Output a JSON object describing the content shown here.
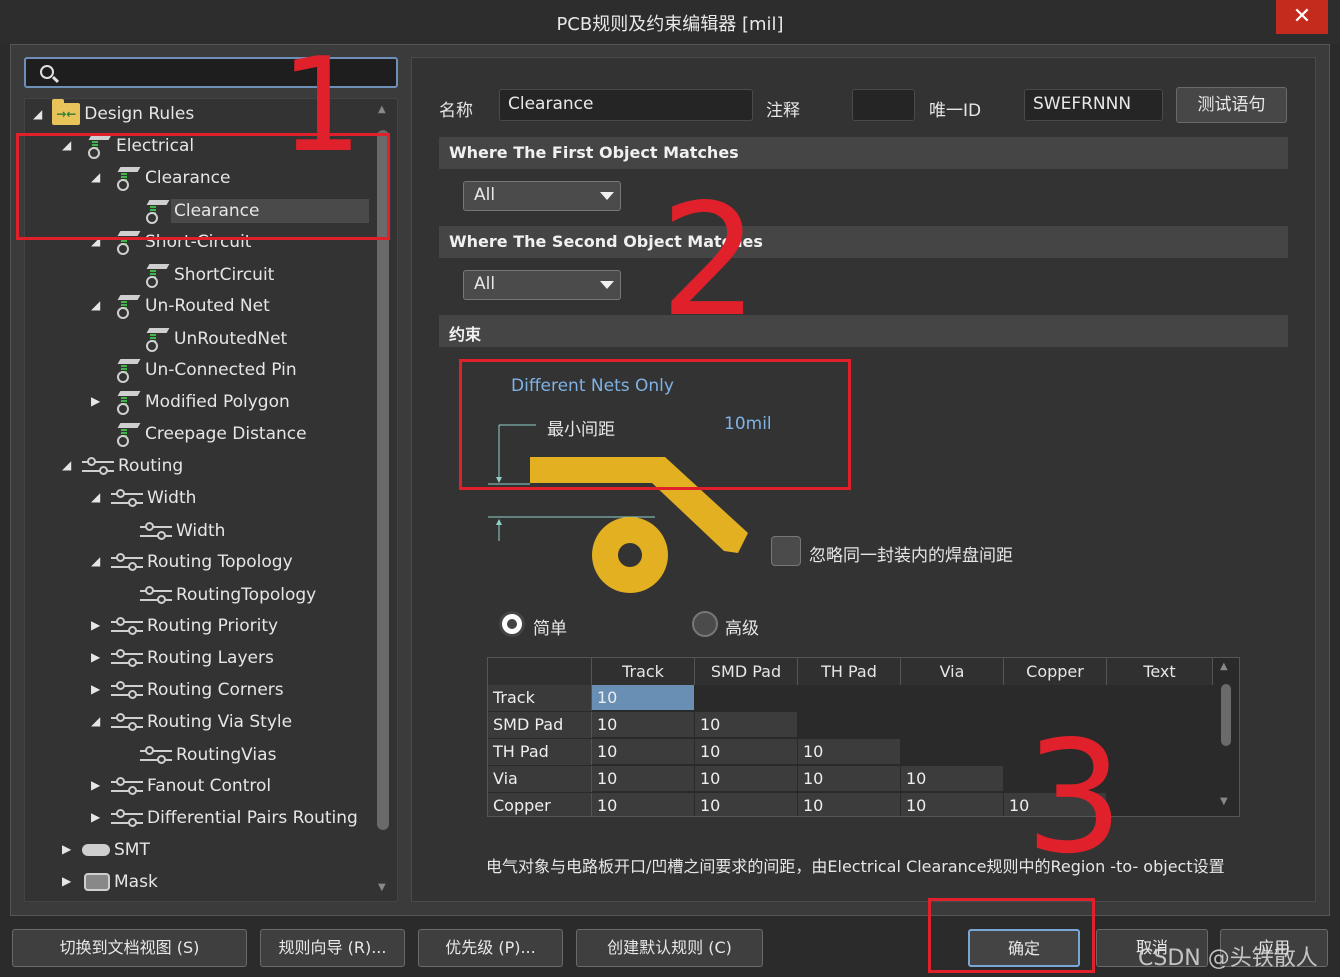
{
  "window": {
    "title": "PCB规则及约束编辑器 [mil]",
    "close_glyph": "✕"
  },
  "tree": {
    "root": "Design Rules",
    "items": [
      {
        "label": "Electrical"
      },
      {
        "label": "Clearance"
      },
      {
        "label": "Clearance"
      },
      {
        "label": "Short-Circuit"
      },
      {
        "label": "ShortCircuit"
      },
      {
        "label": "Un-Routed Net"
      },
      {
        "label": "UnRoutedNet"
      },
      {
        "label": "Un-Connected Pin"
      },
      {
        "label": "Modified Polygon"
      },
      {
        "label": "Creepage Distance"
      },
      {
        "label": "Routing"
      },
      {
        "label": "Width"
      },
      {
        "label": "Width"
      },
      {
        "label": "Routing Topology"
      },
      {
        "label": "RoutingTopology"
      },
      {
        "label": "Routing Priority"
      },
      {
        "label": "Routing Layers"
      },
      {
        "label": "Routing Corners"
      },
      {
        "label": "Routing Via Style"
      },
      {
        "label": "RoutingVias"
      },
      {
        "label": "Fanout Control"
      },
      {
        "label": "Differential Pairs Routing"
      },
      {
        "label": "SMT"
      },
      {
        "label": "Mask"
      }
    ]
  },
  "rule": {
    "name_label": "名称",
    "name_value": "Clearance",
    "comment_label": "注释",
    "comment_value": "",
    "id_label": "唯一ID",
    "id_value": "SWEFRNNN",
    "test_button": "测试语句"
  },
  "first_match": {
    "title": "Where The First Object Matches",
    "value": "All"
  },
  "second_match": {
    "title": "Where The Second Object Matches",
    "value": "All"
  },
  "constraint": {
    "title": "约束",
    "net_scope": "Different Nets Only",
    "min_clearance_label": "最小间距",
    "min_clearance_value": "10mil",
    "ignore_pad_label": "忽略同一封装内的焊盘间距",
    "mode_simple": "简单",
    "mode_advanced": "高级"
  },
  "grid": {
    "columns": [
      "Track",
      "SMD Pad",
      "TH Pad",
      "Via",
      "Copper",
      "Text"
    ],
    "rows": [
      {
        "name": "Track",
        "values": [
          "10"
        ]
      },
      {
        "name": "SMD Pad",
        "values": [
          "10",
          "10"
        ]
      },
      {
        "name": "TH Pad",
        "values": [
          "10",
          "10",
          "10"
        ]
      },
      {
        "name": "Via",
        "values": [
          "10",
          "10",
          "10",
          "10"
        ]
      },
      {
        "name": "Copper",
        "values": [
          "10",
          "10",
          "10",
          "10",
          "10"
        ]
      }
    ]
  },
  "description": "电气对象与电路板开口/凹槽之间要求的间距，由Electrical Clearance规则中的Region -to- object设置",
  "buttons": {
    "switch_view": "切换到文档视图 (S)",
    "wizard": "规则向导 (R)...",
    "priority": "优先级 (P)...",
    "create_default": "创建默认规则 (C)",
    "ok": "确定",
    "cancel": "取消",
    "apply": "应用"
  },
  "annotations": {
    "n1": "1",
    "n2": "2",
    "n3": "3"
  },
  "watermark": "CSDN @头铁散人",
  "colors": {
    "accent": "#e0202a",
    "copper": "#e2b021",
    "link_blue": "#7fb2e5"
  }
}
